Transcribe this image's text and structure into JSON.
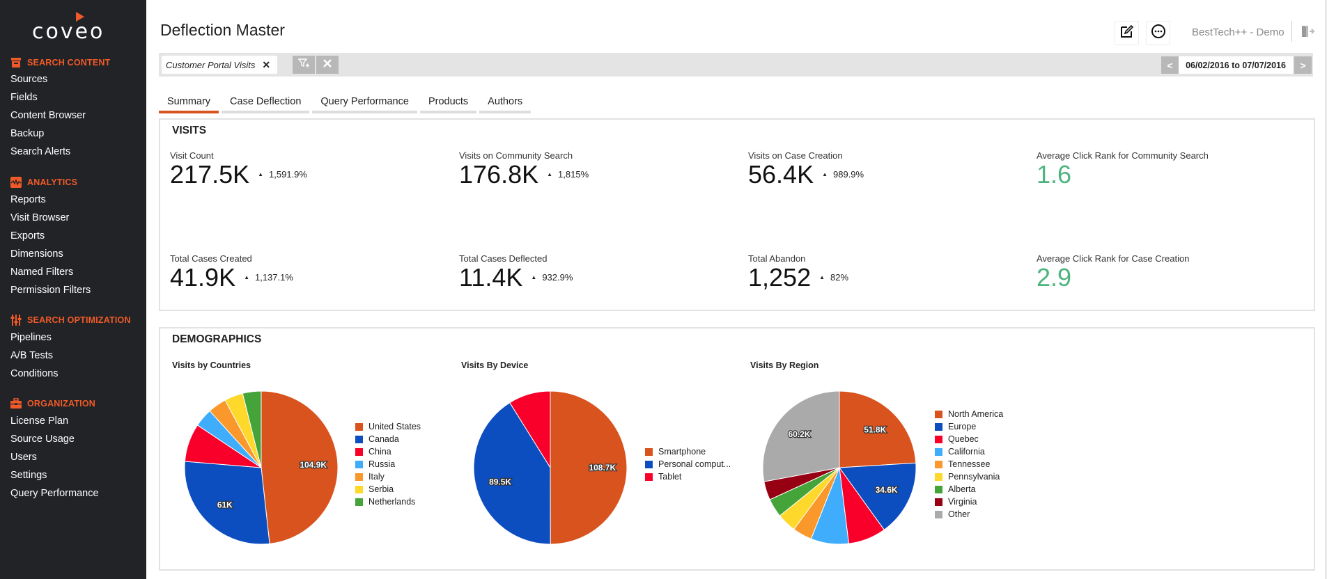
{
  "sidebar": {
    "logo": "coveo",
    "sections": [
      {
        "title": "SEARCH CONTENT",
        "icon": "archive-box-icon",
        "items": [
          "Sources",
          "Fields",
          "Content Browser",
          "Backup",
          "Search Alerts"
        ]
      },
      {
        "title": "ANALYTICS",
        "icon": "activity-chart-icon",
        "items": [
          "Reports",
          "Visit Browser",
          "Exports",
          "Dimensions",
          "Named Filters",
          "Permission Filters"
        ]
      },
      {
        "title": "SEARCH OPTIMIZATION",
        "icon": "sliders-icon",
        "items": [
          "Pipelines",
          "A/B Tests",
          "Conditions"
        ]
      },
      {
        "title": "ORGANIZATION",
        "icon": "briefcase-icon",
        "items": [
          "License Plan",
          "Source Usage",
          "Users",
          "Settings",
          "Query Performance"
        ]
      }
    ]
  },
  "header": {
    "title": "Deflection Master",
    "org_name": "BestTech++ - Demo",
    "edit_icon": "edit-icon",
    "more_icon": "more-options-icon",
    "exit_icon": "logout-icon"
  },
  "filter": {
    "chip_label": "Customer Portal Visits",
    "chip_remove": "✕",
    "add_filter_icon": "add-filter-icon",
    "clear_icon": "clear-filters-icon"
  },
  "date_range": {
    "prev": "<",
    "next": ">",
    "text": "06/02/2016 to 07/07/2016"
  },
  "tabs": [
    {
      "label": "Summary",
      "active": true
    },
    {
      "label": "Case Deflection",
      "active": false
    },
    {
      "label": "Query Performance",
      "active": false
    },
    {
      "label": "Products",
      "active": false
    },
    {
      "label": "Authors",
      "active": false
    }
  ],
  "visits": {
    "title": "VISITS",
    "kpis": [
      {
        "label": "Visit Count",
        "value": "217.5K",
        "trend": "up",
        "change": "1,591.9%"
      },
      {
        "label": "Visits on Community Search",
        "value": "176.8K",
        "trend": "up",
        "change": "1,815%"
      },
      {
        "label": "Visits on Case Creation",
        "value": "56.4K",
        "trend": "up",
        "change": "989.9%"
      },
      {
        "label": "Average Click Rank for Community Search",
        "value": "1.6",
        "highlight": "#4bb57d"
      },
      {
        "label": "Total Cases Created",
        "value": "41.9K",
        "trend": "up",
        "change": "1,137.1%"
      },
      {
        "label": "Total Cases Deflected",
        "value": "11.4K",
        "trend": "up",
        "change": "932.9%"
      },
      {
        "label": "Total Abandon",
        "value": "1,252",
        "trend": "up",
        "change": "82%"
      },
      {
        "label": "Average Click Rank for Case Creation",
        "value": "2.9",
        "highlight": "#4bb57d"
      }
    ],
    "trend_glyph": "▲"
  },
  "demographics": {
    "title": "DEMOGRAPHICS"
  },
  "chart_data": [
    {
      "type": "pie",
      "title": "Visits by Countries",
      "legend": "right",
      "categories": [
        "United States",
        "Canada",
        "China",
        "Russia",
        "Italy",
        "Serbia",
        "Netherlands"
      ],
      "values": [
        104.9,
        61,
        17.5,
        8.5,
        8.5,
        8.5,
        8.5
      ],
      "unit": "K",
      "data_labels": [
        "104.9K",
        "61K",
        "",
        "",
        "",
        "",
        ""
      ],
      "colors": [
        "#d9531e",
        "#0c4ebf",
        "#f8002a",
        "#3fadfb",
        "#fa982b",
        "#fed82b",
        "#44a43a"
      ]
    },
    {
      "type": "pie",
      "title": "Visits By Device",
      "legend": "right",
      "categories": [
        "Smartphone",
        "Personal comput...",
        "Tablet"
      ],
      "values": [
        108.7,
        89.5,
        19.3
      ],
      "unit": "K",
      "data_labels": [
        "108.7K",
        "89.5K",
        ""
      ],
      "colors": [
        "#d9531e",
        "#0c4ebf",
        "#f8002a"
      ]
    },
    {
      "type": "pie",
      "title": "Visits By Region",
      "legend": "right",
      "categories": [
        "North America",
        "Europe",
        "Quebec",
        "California",
        "Tennessee",
        "Pennsylvania",
        "Alberta",
        "Virginia",
        "Other"
      ],
      "values": [
        51.8,
        34.6,
        17.2,
        17.2,
        8.8,
        8.8,
        8.5,
        8.5,
        60.2
      ],
      "unit": "K",
      "data_labels": [
        "51.8K",
        "34.6K",
        "",
        "",
        "",
        "",
        "",
        "",
        "60.2K"
      ],
      "colors": [
        "#d9531e",
        "#0c4ebf",
        "#f8002a",
        "#3fadfb",
        "#fa982b",
        "#fed82b",
        "#44a43a",
        "#960012",
        "#aaaaaa"
      ]
    }
  ]
}
